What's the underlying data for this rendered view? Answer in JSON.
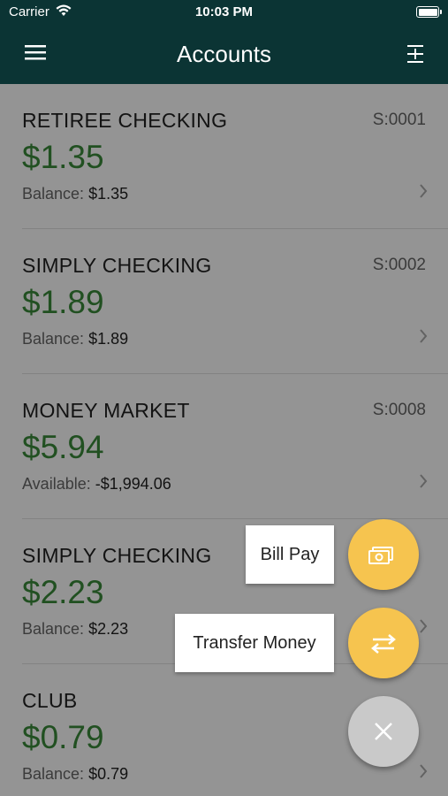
{
  "status_bar": {
    "carrier": "Carrier",
    "time": "10:03 PM"
  },
  "header": {
    "title": "Accounts",
    "menu_icon": "hamburger-menu-icon",
    "action_icon": "expand-collapse-icon"
  },
  "accounts": [
    {
      "name": "RETIREE CHECKING",
      "suffix": "S:0001",
      "amount": "$1.35",
      "balance_label": "Balance:",
      "balance_value": "$1.35"
    },
    {
      "name": "SIMPLY CHECKING",
      "suffix": "S:0002",
      "amount": "$1.89",
      "balance_label": "Balance:",
      "balance_value": "$1.89"
    },
    {
      "name": "MONEY MARKET",
      "suffix": "S:0008",
      "amount": "$5.94",
      "balance_label": "Available:",
      "balance_value": "-$1,994.06"
    },
    {
      "name": "SIMPLY CHECKING",
      "suffix": "",
      "amount": "$2.23",
      "balance_label": "Balance:",
      "balance_value": "$2.23"
    },
    {
      "name": "CLUB",
      "suffix": "",
      "amount": "$0.79",
      "balance_label": "Balance:",
      "balance_value": "$0.79"
    }
  ],
  "fab_menu": {
    "bill_pay_label": "Bill Pay",
    "transfer_label": "Transfer Money",
    "bill_pay_icon": "money-icon",
    "transfer_icon": "transfer-arrows-icon",
    "close_icon": "close-icon"
  },
  "colors": {
    "header_bg": "#0b3434",
    "amount_green": "#3a8a3a",
    "fab_yellow": "#f6c44f",
    "fab_close": "#c9c9c9"
  }
}
